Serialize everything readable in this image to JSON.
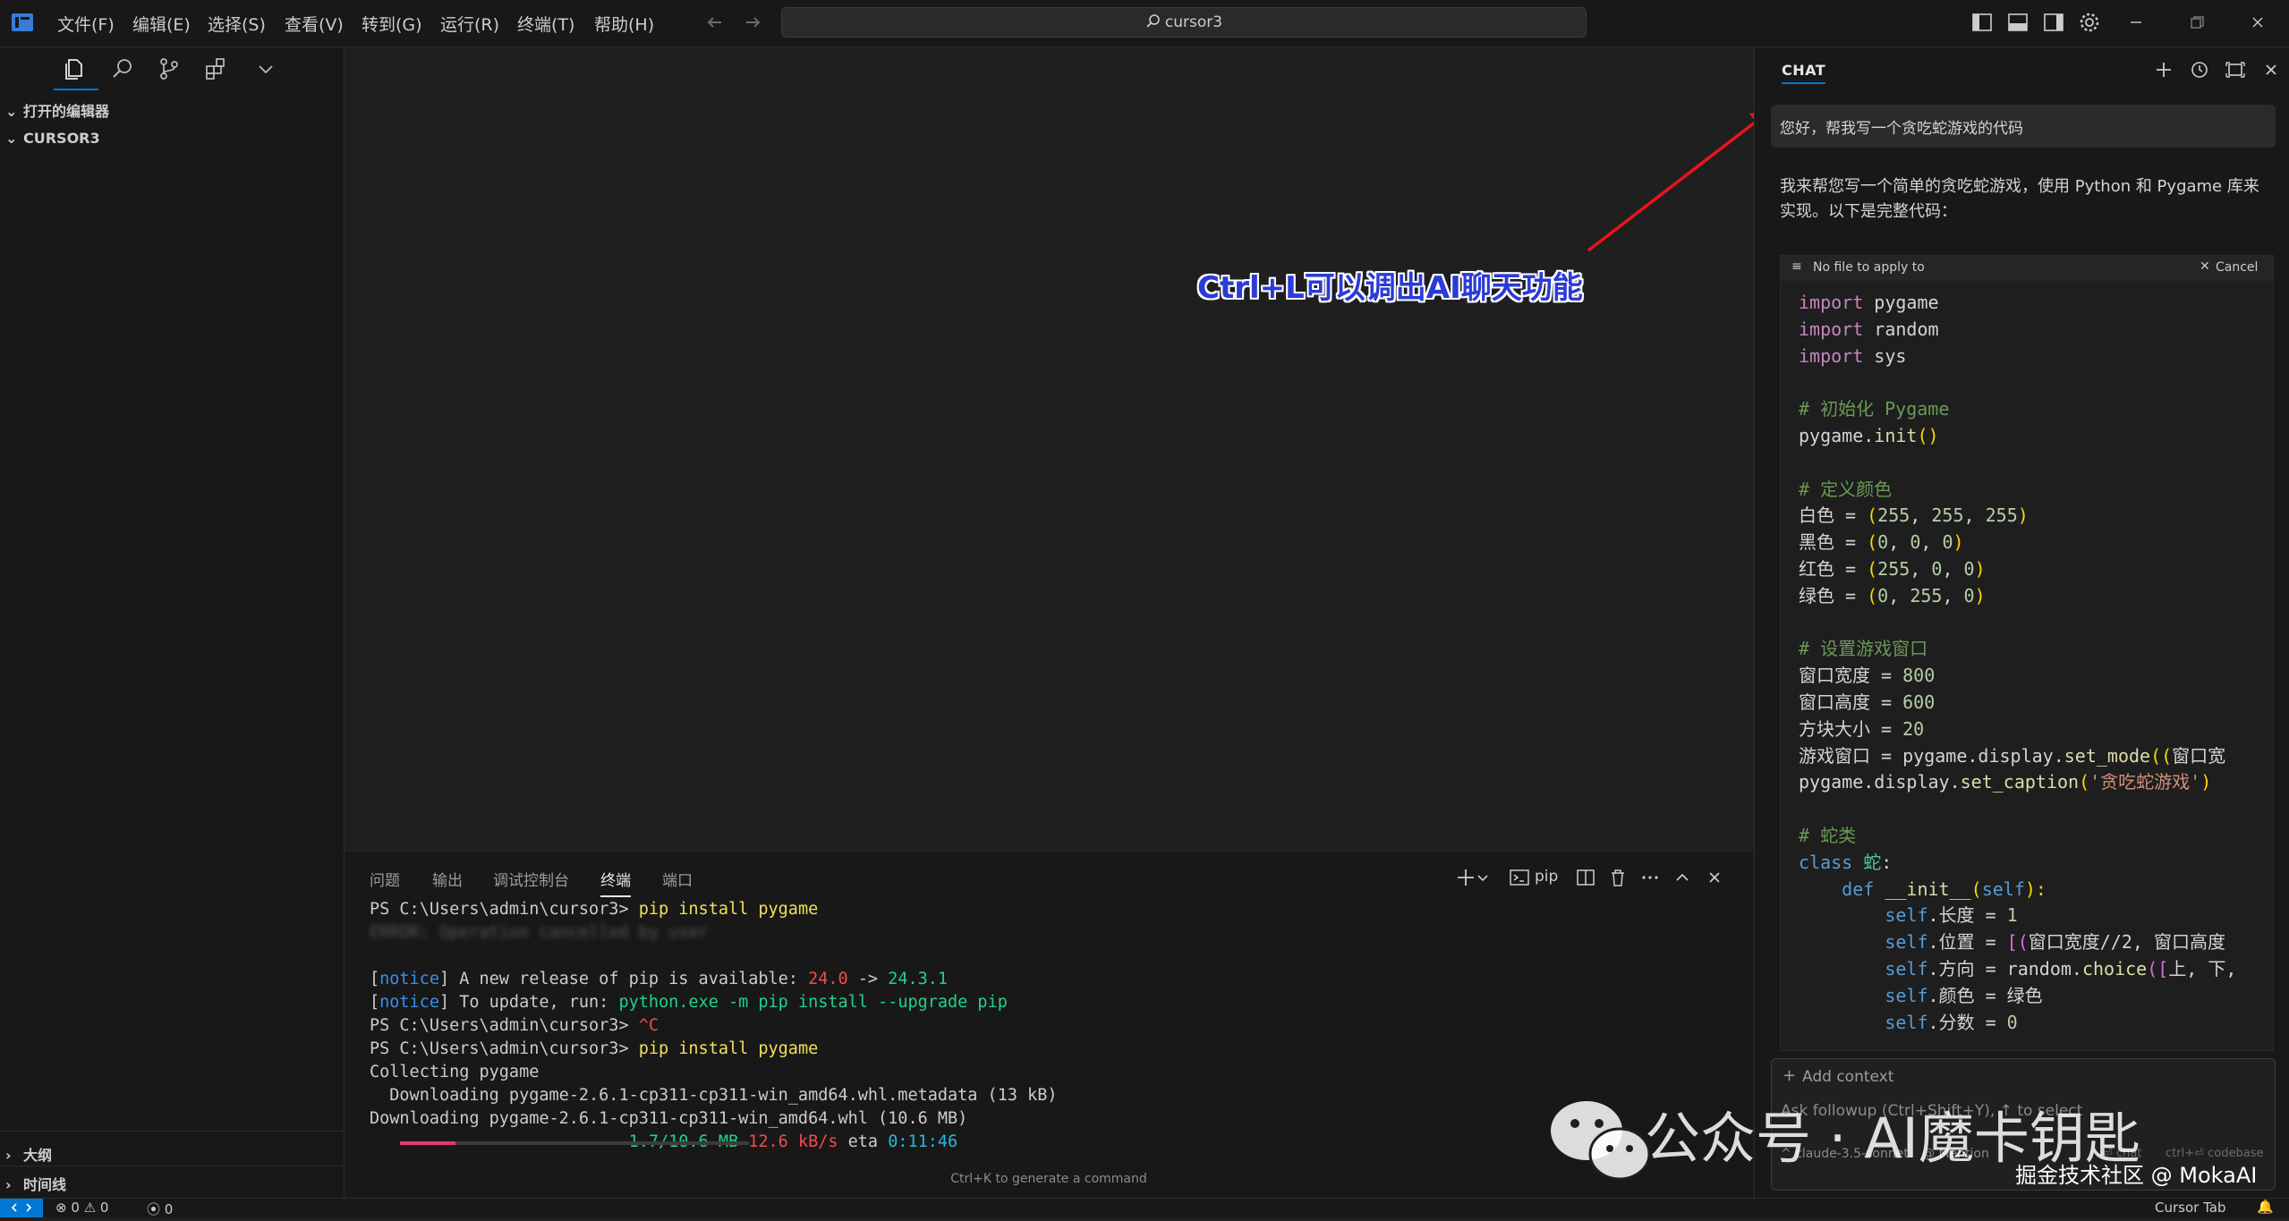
{
  "titlebar": {
    "menus": [
      "文件(F)",
      "编辑(E)",
      "选择(S)",
      "查看(V)",
      "转到(G)",
      "运行(R)",
      "终端(T)",
      "帮助(H)"
    ],
    "search_text": "cursor3"
  },
  "sidebar": {
    "open_editors": "打开的编辑器",
    "folder": "CURSOR3",
    "outline": "大纲",
    "timeline": "时间线"
  },
  "annotation": {
    "text": "Ctrl+L可以调出AI聊天功能"
  },
  "panel": {
    "tabs": [
      "问题",
      "输出",
      "调试控制台",
      "终端",
      "端口"
    ],
    "active_tab": "终端",
    "terminal_profile": "pip",
    "hint": "Ctrl+K to generate a command",
    "terminal": {
      "prompt1": "PS C:\\Users\\admin\\cursor3> ",
      "cmd1": "pip install pygame",
      "blurred": "ERROR: Operation cancelled by user",
      "notice_tag": "notice",
      "notice1_text": " A new release of pip is available: ",
      "ver_old": "24.0",
      "arrow": " -> ",
      "ver_new": "24.3.1",
      "notice2_text": " To update, run: ",
      "update_cmd": "python.exe -m pip install --upgrade pip",
      "prompt2": "PS C:\\Users\\admin\\cursor3> ",
      "ctrlc": "^C",
      "prompt3": "PS C:\\Users\\admin\\cursor3> ",
      "cmd3": "pip install pygame",
      "collecting": "Collecting pygame",
      "dl_meta": "  Downloading pygame-2.6.1-cp311-cp311-win_amd64.whl.metadata (13 kB)",
      "dl_whl": "Downloading pygame-2.6.1-cp311-cp311-win_amd64.whl (10.6 MB)",
      "progress_size": "1.7/10.6 MB",
      "progress_speed": "12.6 kB/s",
      "progress_eta_label": "eta",
      "progress_eta": "0:11:46",
      "progress_fraction": 0.16
    }
  },
  "chat": {
    "tab": "CHAT",
    "user_message": "您好，帮我写一个贪吃蛇游戏的代码",
    "ai_intro": "我来帮您写一个简单的贪吃蛇游戏，使用 Python 和 Pygame 库来实现。以下是完整代码：",
    "code_header_label": "No file to apply to",
    "code_header_cancel": "Cancel",
    "add_context": "Add context",
    "followup_placeholder": "Ask followup (Ctrl+Shift+Y), ↑ to select",
    "model": "claude-3.5-sonnet",
    "mention": "@ Mention",
    "chat_hint": "⏎ chat",
    "codebase_hint": "ctrl+⏎ codebase"
  },
  "code_lines": {
    "l1a": "import",
    "l1b": " pygame",
    "l2a": "import",
    "l2b": " random",
    "l3a": "import",
    "l3b": " sys",
    "l5": "# 初始化 Pygame",
    "l6a": "pygame.",
    "l6b": "init",
    "l6c": "()",
    "l8": "# 定义颜色",
    "l9a": "白色 = ",
    "l9b": "(",
    "l9c": "255",
    "l9d": ", ",
    "l9e": "255",
    "l9f": ", ",
    "l9g": "255",
    "l9h": ")",
    "l10a": "黑色 = ",
    "l10b": "(",
    "l10c": "0",
    "l10d": ", ",
    "l10e": "0",
    "l10f": ", ",
    "l10g": "0",
    "l10h": ")",
    "l11a": "红色 = ",
    "l11b": "(",
    "l11c": "255",
    "l11d": ", ",
    "l11e": "0",
    "l11f": ", ",
    "l11g": "0",
    "l11h": ")",
    "l12a": "绿色 = ",
    "l12b": "(",
    "l12c": "0",
    "l12d": ", ",
    "l12e": "255",
    "l12f": ", ",
    "l12g": "0",
    "l12h": ")",
    "l14": "# 设置游戏窗口",
    "l15a": "窗口宽度 = ",
    "l15b": "800",
    "l16a": "窗口高度 = ",
    "l16b": "600",
    "l17a": "方块大小 = ",
    "l17b": "20",
    "l18a": "游戏窗口 = pygame.display.",
    "l18b": "set_mode",
    "l18c": "((",
    "l18d": "窗口宽",
    "l19a": "pygame.display.",
    "l19b": "set_caption",
    "l19c": "(",
    "l19d": "'贪吃蛇游戏'",
    "l19e": ")",
    "l21": "# 蛇类",
    "l22a": "class",
    "l22b": " 蛇",
    "l22c": ":",
    "l23a": "    def",
    "l23b": " __init__",
    "l23c": "(",
    "l23d": "self",
    "l23e": "):",
    "l24a": "        self",
    "l24b": ".长度 = ",
    "l24c": "1",
    "l25a": "        self",
    "l25b": ".位置 = ",
    "l25c": "[(",
    "l25d": "窗口宽度//2, 窗口高度",
    "l26a": "        self",
    "l26b": ".方向 = random.",
    "l26c": "choice",
    "l26d": "([",
    "l26e": "上, 下,",
    "l27a": "        self",
    "l27b": ".颜色 = 绿色",
    "l28a": "        self",
    "l28b": ".分数 = ",
    "l28c": "0"
  },
  "watermark": {
    "main": "公众号 · AI魔卡钥匙",
    "sub": "掘金技术社区 @ MokaAI"
  },
  "statusbar": {
    "errors": "0",
    "warnings": "0",
    "ports": "0",
    "cursor_tab": "Cursor Tab"
  }
}
